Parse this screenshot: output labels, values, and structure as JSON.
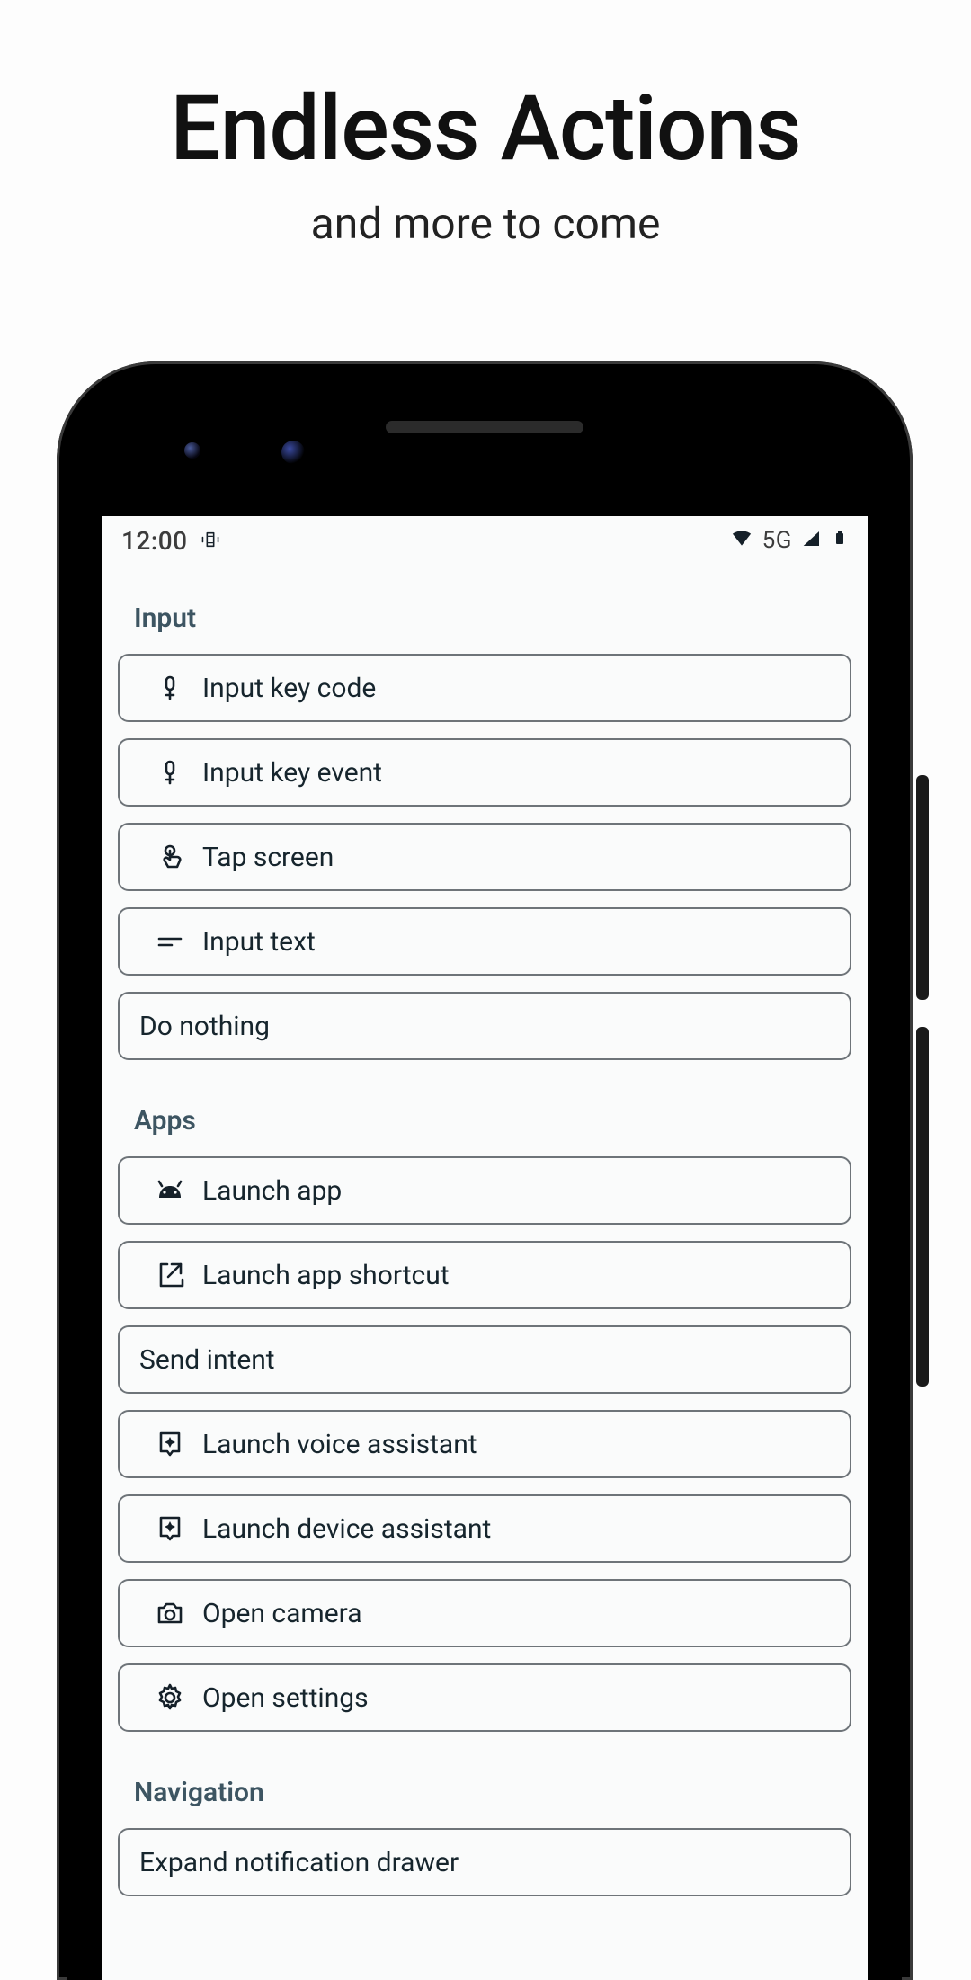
{
  "hero": {
    "title": "Endless Actions",
    "subtitle": "and more to come"
  },
  "statusbar": {
    "time": "12:00",
    "network_label": "5G"
  },
  "sections": [
    {
      "title": "Input",
      "items": [
        {
          "icon": "key-outline",
          "label": "Input key code"
        },
        {
          "icon": "key-outline",
          "label": "Input key event"
        },
        {
          "icon": "touch",
          "label": "Tap screen"
        },
        {
          "icon": "short-text",
          "label": "Input text"
        },
        {
          "icon": null,
          "label": "Do nothing"
        }
      ]
    },
    {
      "title": "Apps",
      "items": [
        {
          "icon": "android",
          "label": "Launch app"
        },
        {
          "icon": "open-in-new",
          "label": "Launch app shortcut"
        },
        {
          "icon": null,
          "label": "Send intent"
        },
        {
          "icon": "assistant",
          "label": "Launch voice assistant"
        },
        {
          "icon": "assistant",
          "label": "Launch device assistant"
        },
        {
          "icon": "camera",
          "label": "Open camera"
        },
        {
          "icon": "gear",
          "label": "Open settings"
        }
      ]
    },
    {
      "title": "Navigation",
      "items": [
        {
          "icon": null,
          "label": "Expand notification drawer"
        }
      ]
    }
  ]
}
